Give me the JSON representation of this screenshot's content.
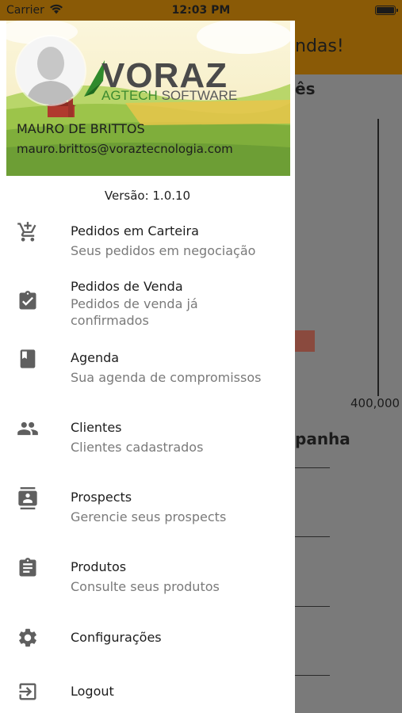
{
  "status_bar": {
    "carrier": "Carrier",
    "time": "12:03 PM",
    "battery_level": 1.0
  },
  "background_app": {
    "title_fragment": "ndas!",
    "section1_fragment": "ês",
    "axis_label": "400,000",
    "section2_fragment": "panha"
  },
  "drawer": {
    "user": {
      "name": "MAURO DE BRITTOS",
      "email": "mauro.brittos@voraztecnologia.com"
    },
    "logo": {
      "main": "VORAZ",
      "sub_agtech": "AGTECH",
      "sub_software": "SOFTWARE"
    },
    "version": "Versão: 1.0.10",
    "items": [
      {
        "icon": "cart-add-icon",
        "title": "Pedidos em Carteira",
        "subtitle": "Seus pedidos em negociação"
      },
      {
        "icon": "clipboard-check-icon",
        "title": "Pedidos de Venda",
        "subtitle": "Pedidos de venda já confirmados"
      },
      {
        "icon": "book-icon",
        "title": "Agenda",
        "subtitle": "Sua agenda de compromissos"
      },
      {
        "icon": "people-icon",
        "title": "Clientes",
        "subtitle": "Clientes cadastrados"
      },
      {
        "icon": "contact-card-icon",
        "title": "Prospects",
        "subtitle": "Gerencie seus prospects"
      },
      {
        "icon": "clipboard-list-icon",
        "title": "Produtos",
        "subtitle": "Consulte seus produtos"
      },
      {
        "icon": "gear-icon",
        "title": "Configurações"
      },
      {
        "icon": "logout-icon",
        "title": "Logout"
      }
    ]
  },
  "colors": {
    "accent": "#8a5a06",
    "drawer_bg": "#ffffff",
    "icon": "#5f5f5f",
    "subtitle": "#7a7a7a"
  }
}
